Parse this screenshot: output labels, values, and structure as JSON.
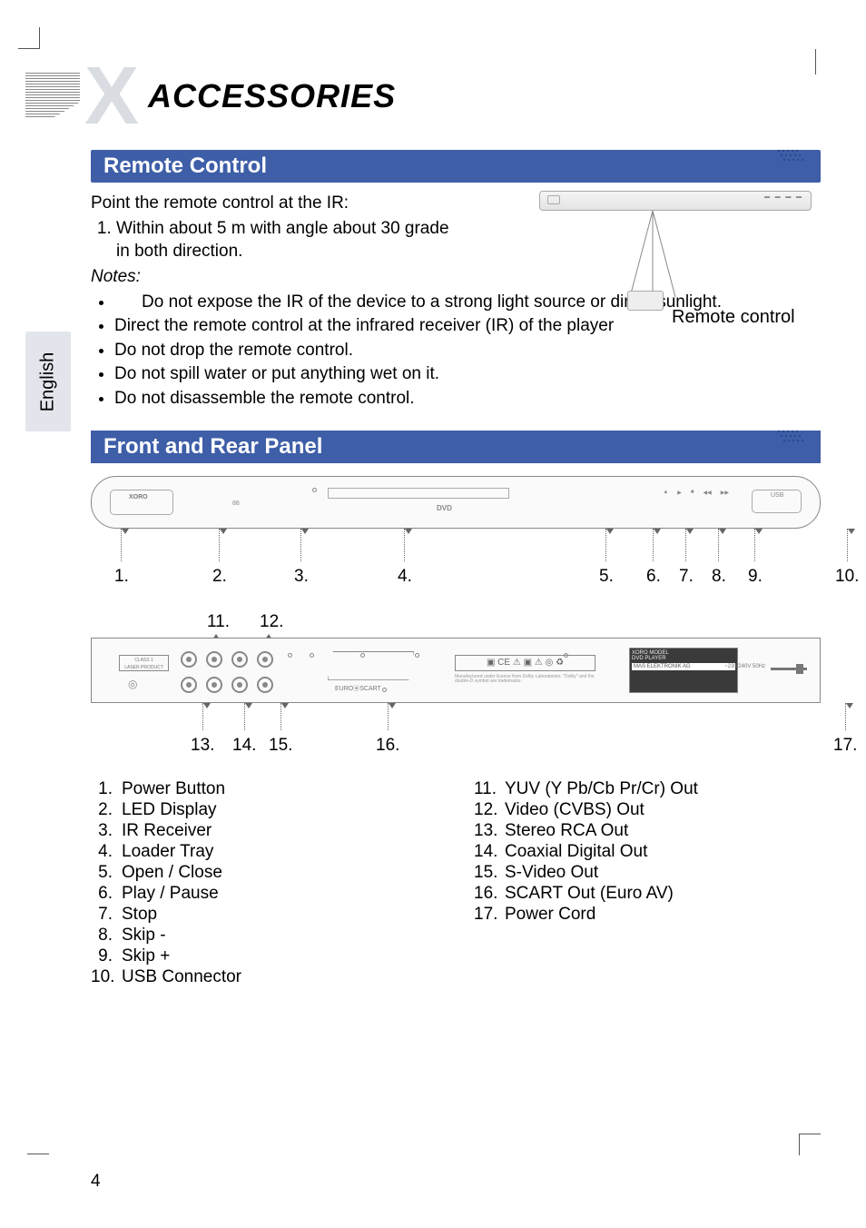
{
  "page": {
    "title": "ACCESSORIES",
    "language_tab": "English",
    "page_number": "4"
  },
  "section1": {
    "heading": "Remote Control",
    "intro": "Point the remote control at the IR:",
    "ordered_item": "Within about 5 m with angle about 30 grade in both direction.",
    "notes_label": "Notes:",
    "bullets": [
      "Do not expose the IR of the device to a strong light source or direct sunlight.",
      "Direct the remote control at the infrared receiver (IR) of the player",
      "Do not drop the remote control.",
      "Do not spill water or put anything wet on it.",
      "Do not disassemble the remote control."
    ],
    "figure_label": "Remote control"
  },
  "section2": {
    "heading": "Front and Rear Panel",
    "front_callouts": [
      "1.",
      "2.",
      "3.",
      "4.",
      "5.",
      "6.",
      "7.",
      "8.",
      "9.",
      "10."
    ],
    "rear_top_callouts": [
      "11.",
      "12."
    ],
    "rear_bottom_callouts": [
      "13.",
      "14.",
      "15.",
      "16.",
      "17."
    ]
  },
  "legend_left": [
    {
      "n": "1.",
      "t": "Power Button"
    },
    {
      "n": "2.",
      "t": "LED Display"
    },
    {
      "n": "3.",
      "t": "IR Receiver"
    },
    {
      "n": "4.",
      "t": "Loader Tray"
    },
    {
      "n": "5.",
      "t": "Open / Close"
    },
    {
      "n": "6.",
      "t": "Play / Pause"
    },
    {
      "n": "7.",
      "t": "Stop"
    },
    {
      "n": "8.",
      "t": "Skip -"
    },
    {
      "n": "9.",
      "t": "Skip +"
    },
    {
      "n": "10.",
      "t": "USB Connector"
    }
  ],
  "legend_right": [
    {
      "n": "11.",
      "t": "YUV (Y Pb/Cb Pr/Cr) Out"
    },
    {
      "n": "12.",
      "t": "Video (CVBS) Out"
    },
    {
      "n": "13.",
      "t": "Stereo RCA Out"
    },
    {
      "n": "14.",
      "t": "Coaxial Digital Out"
    },
    {
      "n": "15.",
      "t": "S-Video Out"
    },
    {
      "n": "16.",
      "t": "SCART Out (Euro AV)"
    },
    {
      "n": "17.",
      "t": "Power Cord"
    }
  ]
}
